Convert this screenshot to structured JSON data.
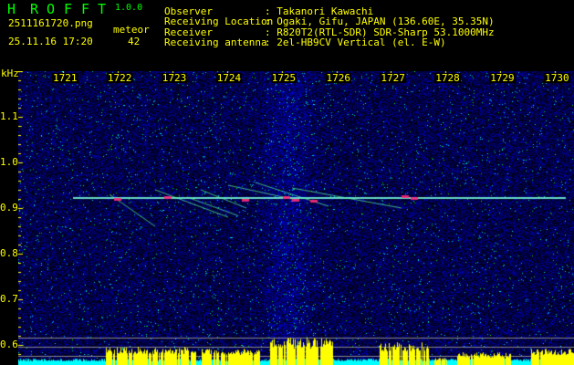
{
  "app": {
    "name_letters": [
      "H",
      "R",
      "O",
      "F",
      "F",
      "T"
    ],
    "version": "1.0.0"
  },
  "file": {
    "name": "2511161720.png",
    "datetime": "25.11.16 17:20"
  },
  "meteor": {
    "label": "meteor",
    "count": "42"
  },
  "info": [
    {
      "label": "Observer",
      "value": ": Takanori Kawachi"
    },
    {
      "label": "Receiving Location",
      "value": ": Ogaki, Gifu, JAPAN (136.60E, 35.35N)"
    },
    {
      "label": "Receiver",
      "value": ": R820T2(RTL-SDR) SDR-Sharp 53.1000MHz"
    },
    {
      "label": "Receiving antenna",
      "value": ": 2el-HB9CV Vertical (el. E-W)"
    }
  ],
  "colors": {
    "text": "#ffff00",
    "title": "#00ff00",
    "background": "#000000",
    "noise": "#0a1aa0",
    "signal_bar": "#ffff00",
    "baseline": "#00ffff"
  },
  "chart_data": {
    "type": "heatmap",
    "ylabel": "kHz",
    "x_ticks": [
      "1721",
      "1722",
      "1723",
      "1724",
      "1725",
      "1726",
      "1727",
      "1728",
      "1729",
      "1730"
    ],
    "y_ticks": [
      "1.1",
      "1.0",
      "0.9",
      "0.8",
      "0.7",
      "0.6"
    ],
    "ylim": [
      0.56,
      1.2
    ],
    "carrier_khz": 0.92,
    "grid": false
  }
}
